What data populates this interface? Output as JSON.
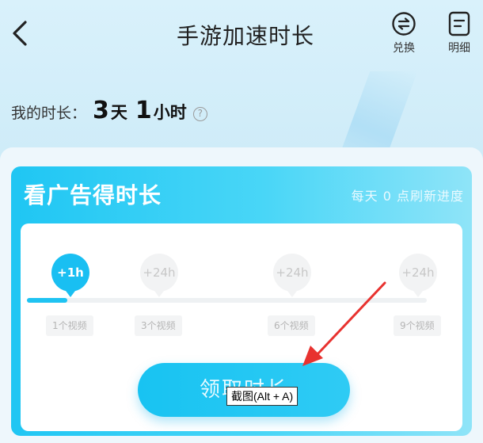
{
  "header": {
    "title": "手游加速时长",
    "exchange_label": "兑换",
    "details_label": "明细"
  },
  "duration": {
    "label": "我的时长：",
    "days": "3",
    "days_unit": "天",
    "hours": "1",
    "hours_unit": "小时",
    "help_glyph": "?"
  },
  "ad_card": {
    "title": "看广告得时长",
    "refresh_hint": "每天 0 点刷新进度",
    "progress_fraction": 0.1,
    "milestones": [
      {
        "reward": "+1h",
        "videos": "1个视频",
        "active": true
      },
      {
        "reward": "+24h",
        "videos": "3个视频",
        "active": false
      },
      {
        "reward": "+24h",
        "videos": "6个视频",
        "active": false
      },
      {
        "reward": "+24h",
        "videos": "9个视频",
        "active": false
      }
    ],
    "claim_label": "领取时长"
  },
  "overlay": {
    "tooltip": "截图(Alt + A)",
    "arrow_color": "#e8322f"
  },
  "colors": {
    "accent": "#19bff2"
  },
  "icons": {
    "back": "back-chevron-icon",
    "exchange": "exchange-icon",
    "details": "details-list-icon",
    "help": "help-icon"
  }
}
